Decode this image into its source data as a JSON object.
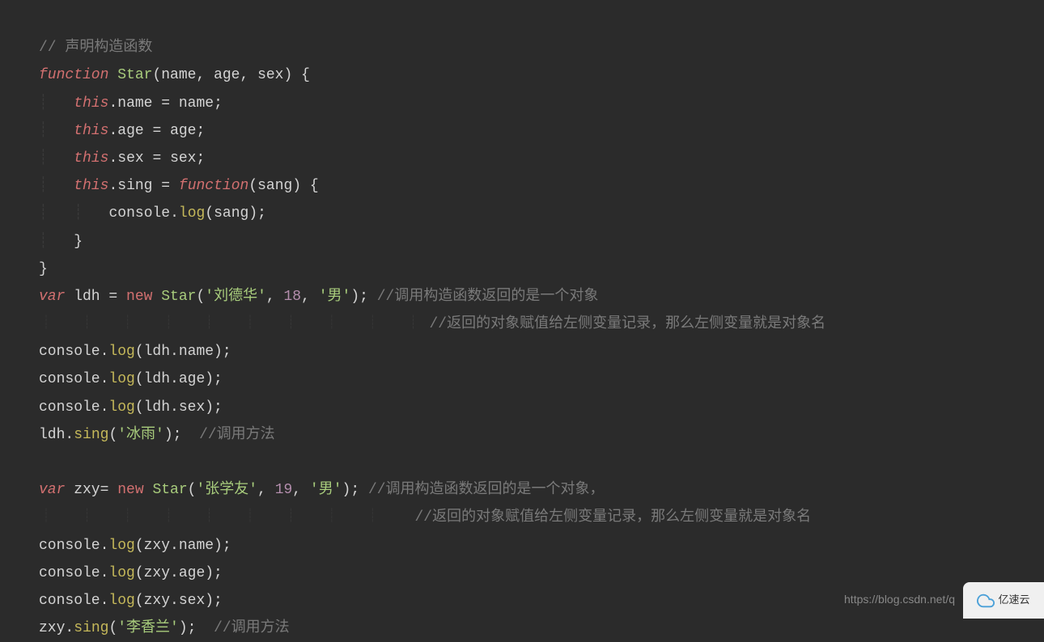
{
  "code": {
    "comment_declare": "// 声明构造函数",
    "function_kw": "function",
    "star_fn": "Star",
    "params": "(name, age, sex) {",
    "this_kw": "this",
    "name_prop": ".name = name;",
    "age_prop": ".age = age;",
    "sex_prop": ".sex = sex;",
    "sing_prop": ".sing = ",
    "function_kw2": "function",
    "sang_param": "(sang) {",
    "console_log": "console.",
    "log_method": "log",
    "sang_arg": "(sang);",
    "close_brace": "}",
    "var_kw": "var",
    "ldh_var": " ldh = ",
    "new_kw": "new",
    "star_call": "Star",
    "ldh_args_open": "(",
    "ldh_name": "'刘德华'",
    "ldh_age": "18",
    "ldh_sex": "'男'",
    "ldh_close": ");",
    "comment_call1": "//调用构造函数返回的是一个对象",
    "comment_call2": "//返回的对象赋值给左侧变量记录，那么左侧变量就是对象名",
    "ldh_name_log": "(ldh.name);",
    "ldh_age_log": "(ldh.age);",
    "ldh_sex_log": "(ldh.sex);",
    "ldh_sing": "ldh.",
    "sing_method": "sing",
    "bingyu": "'冰雨'",
    "comment_method": "//调用方法",
    "zxy_var": " zxy= ",
    "zxy_name": "'张学友'",
    "zxy_age": "19",
    "zxy_sex": "'男'",
    "comment_call3": "//调用构造函数返回的是一个对象，",
    "zxy_name_log": "(zxy.name);",
    "zxy_age_log": "(zxy.age);",
    "zxy_sex_log": "(zxy.sex);",
    "zxy_sing": "zxy.",
    "lixianglan": "'李香兰'",
    "comma": ", "
  },
  "watermark": {
    "url": "https://blog.csdn.net/q",
    "brand": "亿速云"
  }
}
